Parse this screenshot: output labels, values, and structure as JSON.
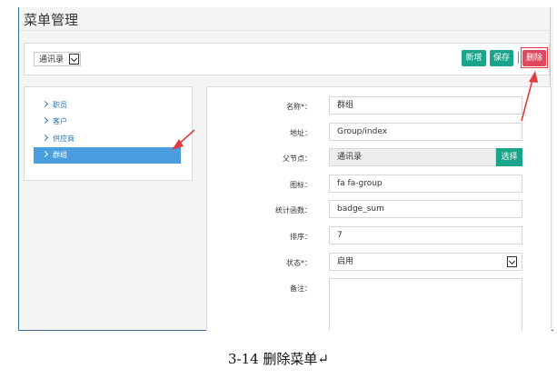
{
  "page": {
    "title": "菜单管理"
  },
  "toolbar": {
    "filter_value": "通讯录",
    "buttons": {
      "add": "新增",
      "save": "保存",
      "delete": "删除"
    }
  },
  "tree": {
    "items": [
      {
        "label": "职员",
        "active": false
      },
      {
        "label": "客户",
        "active": false
      },
      {
        "label": "供应商",
        "active": false
      },
      {
        "label": "群组",
        "active": true
      }
    ]
  },
  "form": {
    "name": {
      "label": "名称*：",
      "value": "群组"
    },
    "address": {
      "label": "地址：",
      "value": "Group/index"
    },
    "parent": {
      "label": "父节点：",
      "value": "通讯录",
      "button": "选择"
    },
    "icon": {
      "label": "图标：",
      "value": "fa fa-group"
    },
    "stat_func": {
      "label": "统计函数：",
      "value": "badge_sum"
    },
    "order": {
      "label": "排序：",
      "value": "7"
    },
    "status": {
      "label": "状态*：",
      "value": "启用"
    },
    "remark": {
      "label": "备注：",
      "value": ""
    }
  },
  "caption": "3-14 删除菜单↵",
  "colors": {
    "primary_green": "#1aa489",
    "danger_red": "#e0485e",
    "tree_active": "#4a9ee0",
    "annotation": "#e23b3b"
  }
}
